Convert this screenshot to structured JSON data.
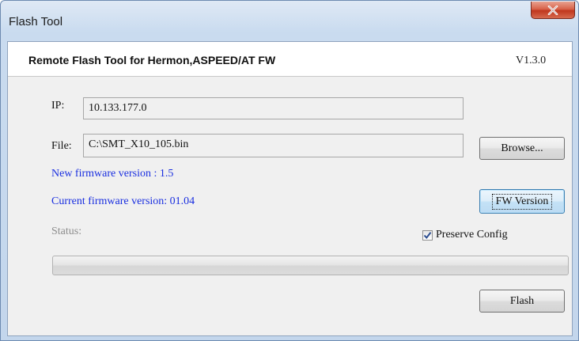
{
  "window": {
    "title": "Flash Tool"
  },
  "header": {
    "app_title": "Remote Flash Tool for Hermon,ASPEED/AT FW",
    "version": "V1.3.0"
  },
  "form": {
    "ip_label": "IP:",
    "ip_value": "10.133.177.0",
    "file_label": "File:",
    "file_value": "C:\\SMT_X10_105.bin",
    "browse_label": "Browse...",
    "new_fw_text": "New firmware version : 1.5",
    "current_fw_text": "Current firmware version: 01.04",
    "fw_version_label": "FW Version",
    "status_label": "Status:",
    "preserve_label": "Preserve Config",
    "preserve_checked": true,
    "progress_value": 0,
    "flash_label": "Flash"
  },
  "colors": {
    "info_text": "#1a2fe0",
    "disabled_text": "#8d8d8d",
    "close_button": "#c7402a"
  }
}
